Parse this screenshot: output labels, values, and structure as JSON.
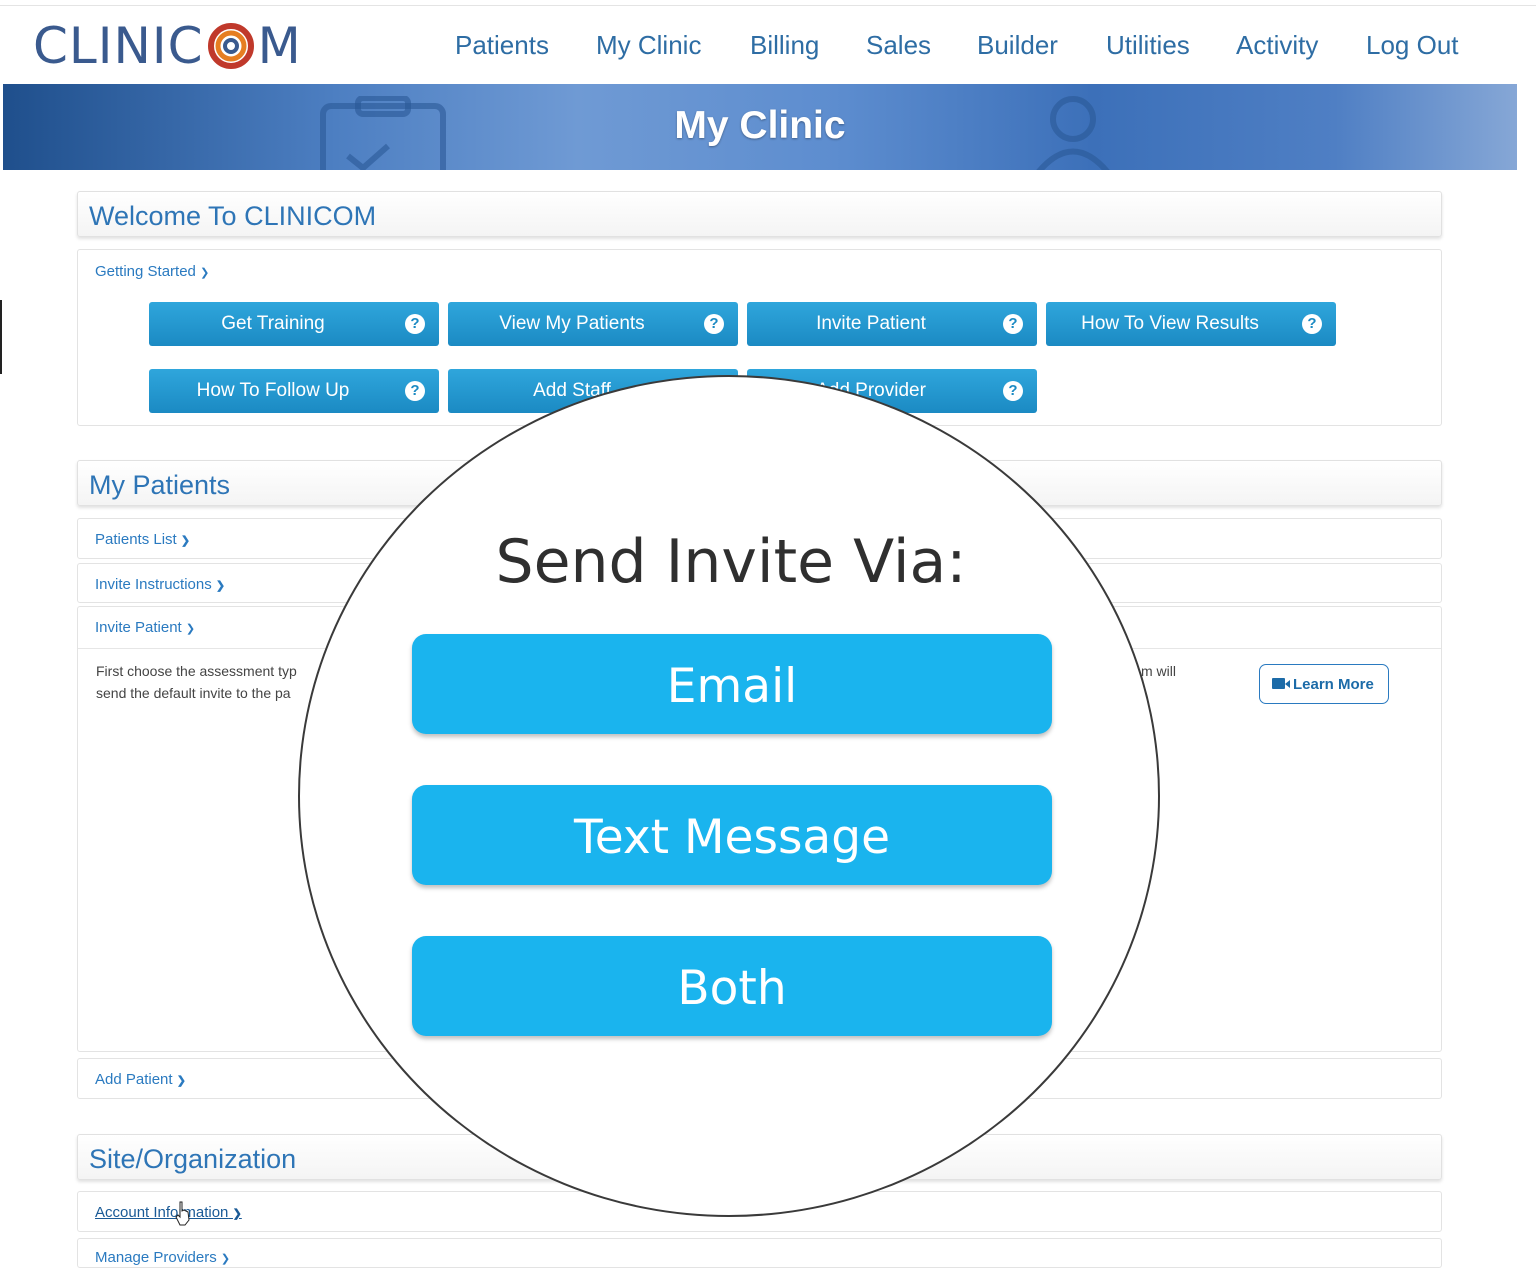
{
  "header": {
    "logo_left": "CLINIC",
    "logo_right": "M",
    "nav": [
      "Patients",
      "My Clinic",
      "Billing",
      "Sales",
      "Builder",
      "Utilities",
      "Activity",
      "Log Out"
    ]
  },
  "banner": {
    "title": "My Clinic"
  },
  "welcome": {
    "title": "Welcome To CLINICOM",
    "getting_started": "Getting Started",
    "buttons": [
      "Get Training",
      "View My Patients",
      "Invite Patient",
      "How To View Results",
      "How To Follow Up",
      "Add Staff",
      "Add Provider"
    ]
  },
  "my_patients": {
    "title": "My Patients",
    "patients_list": "Patients List",
    "invite_instructions": "Invite Instructions",
    "invite_patient": "Invite Patient",
    "text_line1_left": "First choose the assessment typ",
    "text_line2_left": "send the default invite to the pa",
    "text_line1_right": "m will",
    "learn_more": "Learn More",
    "add_patient": "Add Patient"
  },
  "site": {
    "title": "Site/Organization",
    "account_information": "Account Information",
    "manage_providers": "Manage Providers"
  },
  "magnifier": {
    "title": "Send Invite Via:",
    "options": [
      "Email",
      "Text Message",
      "Both"
    ],
    "button_color": "#1ab4ee"
  },
  "colors": {
    "accent": "#2e75b6",
    "button": "#1b8ac3"
  }
}
